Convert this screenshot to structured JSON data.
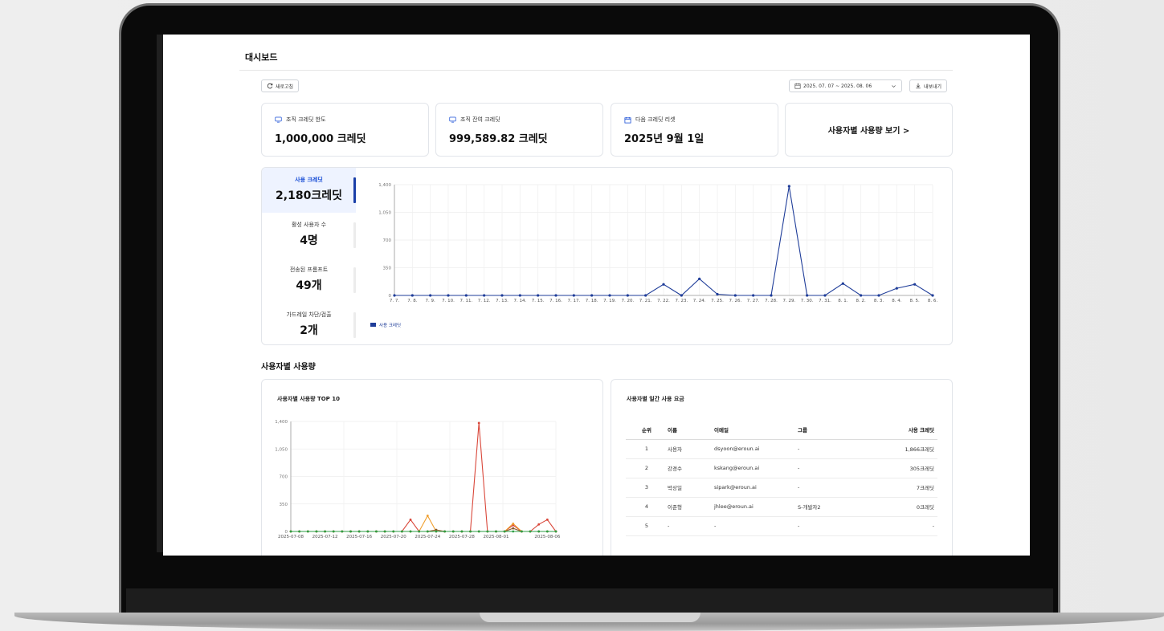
{
  "page": {
    "title": "대시보드"
  },
  "toolbar": {
    "refresh_label": "새로고침",
    "date_range": "2025. 07. 07 ~ 2025. 08. 06",
    "export_label": "내보내기"
  },
  "stats": [
    {
      "label": "조직 크레딧 한도",
      "value": "1,000,000 크레딧",
      "icon": "monitor-icon"
    },
    {
      "label": "조직 잔여 크레딧",
      "value": "999,589.82 크레딧",
      "icon": "monitor-icon"
    },
    {
      "label": "다음 크레딧 리셋",
      "value": "2025년 9월 1일",
      "icon": "calendar-icon"
    }
  ],
  "usage_link": "사용자별 사용량 보기 >",
  "metrics": [
    {
      "label": "사용 크레딧",
      "value": "2,180크레딧",
      "active": true
    },
    {
      "label": "활성 사용자 수",
      "value": "4명",
      "active": false
    },
    {
      "label": "전송된 프롬프트",
      "value": "49개",
      "active": false
    },
    {
      "label": "가드레일 차단/검출",
      "value": "2개",
      "active": false
    }
  ],
  "section": {
    "user_usage_title": "사용자별 사용량"
  },
  "top10": {
    "title": "사용자별 사용량 TOP 10"
  },
  "daily_table": {
    "title": "사용자별 일간 사용 요금",
    "headers": {
      "rank": "순위",
      "name": "이름",
      "email": "이메일",
      "group": "그룹",
      "credits": "사용 크레딧"
    },
    "rows": [
      {
        "rank": "1",
        "name": "사용자",
        "email": "dsyoon@eroun.ai",
        "group": "-",
        "credits": "1,866크레딧"
      },
      {
        "rank": "2",
        "name": "강경수",
        "email": "kskang@eroun.ai",
        "group": "-",
        "credits": "305크레딧"
      },
      {
        "rank": "3",
        "name": "박상일",
        "email": "sipark@eroun.ai",
        "group": "-",
        "credits": "7크레딧"
      },
      {
        "rank": "4",
        "name": "이준형",
        "email": "jhlee@eroun.ai",
        "group": "S-개발자2",
        "credits": "0크레딧"
      },
      {
        "rank": "5",
        "name": "-",
        "email": "-",
        "group": "-",
        "credits": "-"
      }
    ]
  },
  "chart_data": [
    {
      "type": "line",
      "x": [
        "7. 7.",
        "7. 8.",
        "7. 9.",
        "7. 10.",
        "7. 11.",
        "7. 12.",
        "7. 13.",
        "7. 14.",
        "7. 15.",
        "7. 16.",
        "7. 17.",
        "7. 18.",
        "7. 19.",
        "7. 20.",
        "7. 21.",
        "7. 22.",
        "7. 23.",
        "7. 24.",
        "7. 25.",
        "7. 26.",
        "7. 27.",
        "7. 28.",
        "7. 29.",
        "7. 30.",
        "7. 31.",
        "8. 1.",
        "8. 2.",
        "8. 3.",
        "8. 4.",
        "8. 5.",
        "8. 6."
      ],
      "series": [
        {
          "name": "사용 크레딧",
          "color": "#1f3d99",
          "values": [
            0,
            0,
            0,
            0,
            0,
            0,
            0,
            0,
            0,
            0,
            0,
            0,
            0,
            0,
            0,
            140,
            0,
            210,
            15,
            0,
            0,
            0,
            1380,
            0,
            0,
            150,
            0,
            0,
            90,
            140,
            0
          ]
        }
      ],
      "ylim": [
        0,
        1400
      ],
      "yticks": [
        "0",
        "350",
        "700",
        "1,050",
        "1,400"
      ],
      "grid": true,
      "legend": "bottom-left"
    },
    {
      "type": "line",
      "x": [
        "2025-07-08",
        "2025-07-12",
        "2025-07-16",
        "2025-07-20",
        "2025-07-24",
        "2025-07-28",
        "2025-08-01",
        "2025-08-06"
      ],
      "x_ticks_shown": [
        "2025-07-08",
        "2025-07-12",
        "2025-07-16",
        "2025-07-20",
        "2025-07-24",
        "2025-07-28",
        "2025-08-01",
        "2025-08-06"
      ],
      "series": [
        {
          "color": "#d9473a",
          "values": [
            0,
            0,
            0,
            0,
            0,
            0,
            0,
            0,
            0,
            0,
            0,
            0,
            0,
            0,
            150,
            0,
            0,
            0,
            0,
            0,
            0,
            0,
            1380,
            0,
            0,
            0,
            80,
            0,
            0,
            90,
            150,
            0
          ]
        },
        {
          "color": "#f0a030",
          "values": [
            0,
            0,
            0,
            0,
            0,
            0,
            0,
            0,
            0,
            0,
            0,
            0,
            0,
            0,
            0,
            0,
            200,
            0,
            0,
            0,
            0,
            0,
            0,
            0,
            0,
            0,
            100,
            0,
            0,
            0,
            0,
            0
          ]
        },
        {
          "color": "#8b5a2b",
          "values": [
            0,
            0,
            0,
            0,
            0,
            0,
            0,
            0,
            0,
            0,
            0,
            0,
            0,
            0,
            0,
            0,
            0,
            20,
            0,
            0,
            0,
            0,
            0,
            0,
            0,
            0,
            40,
            0,
            0,
            0,
            0,
            0
          ]
        },
        {
          "color": "#2e9e44",
          "values": [
            0,
            0,
            0,
            0,
            0,
            0,
            0,
            0,
            0,
            0,
            0,
            0,
            0,
            0,
            0,
            0,
            0,
            0,
            0,
            0,
            0,
            0,
            0,
            0,
            0,
            0,
            0,
            0,
            0,
            0,
            0,
            0
          ]
        }
      ],
      "ylim": [
        0,
        1400
      ],
      "yticks": [
        "0",
        "350",
        "700",
        "1,050",
        "1,400"
      ],
      "grid": true
    }
  ]
}
